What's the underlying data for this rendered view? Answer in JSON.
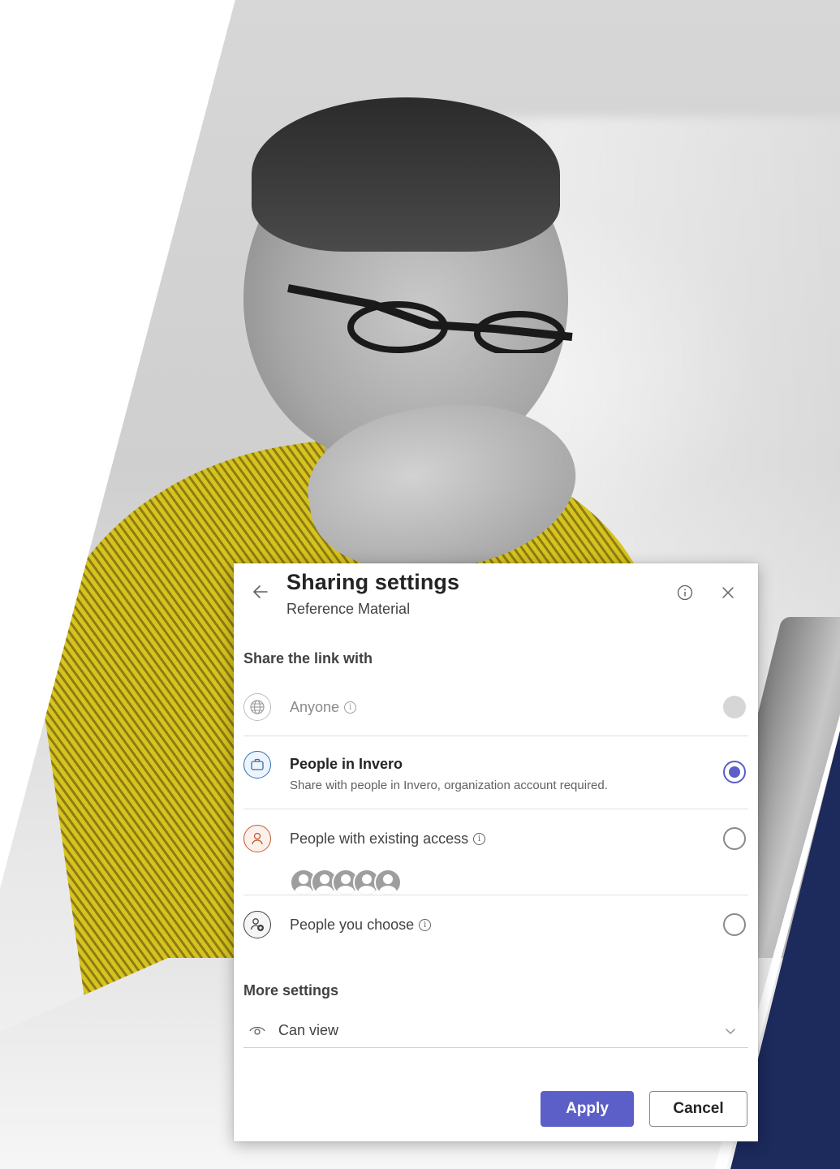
{
  "dialog": {
    "title": "Sharing settings",
    "subtitle": "Reference Material",
    "section_share": "Share the link with",
    "options": [
      {
        "label": "Anyone",
        "description": "",
        "state": "disabled",
        "icon": "globe-icon"
      },
      {
        "label": "People in Invero",
        "description": "Share with people in Invero, organization account required.",
        "state": "selected",
        "icon": "briefcase-icon"
      },
      {
        "label": "People with existing access",
        "description": "",
        "state": "unselected",
        "icon": "person-icon",
        "avatar_count": 5
      },
      {
        "label": "People you choose",
        "description": "",
        "state": "unselected",
        "icon": "person-add-icon"
      }
    ],
    "section_more": "More settings",
    "permission": {
      "value": "Can view",
      "icon": "eye-icon"
    },
    "apply_label": "Apply",
    "cancel_label": "Cancel"
  },
  "colors": {
    "accent": "#5b5fc7",
    "org_icon": "#2f6fb3",
    "existing_access_icon": "#c8592a",
    "navy_stripe": "#1c2a5c",
    "shirt": "#d7c31f"
  }
}
